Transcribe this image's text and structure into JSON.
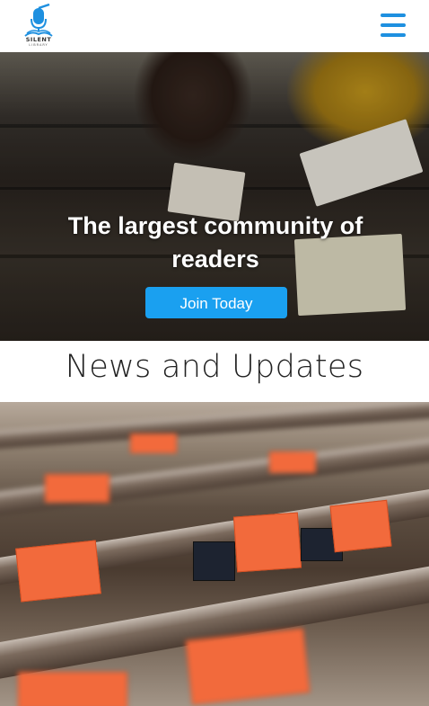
{
  "header": {
    "logo_icon": "microphone-book-icon",
    "logo_text": "SILENT",
    "logo_subtext": "LIBRARY",
    "menu_icon": "hamburger-menu-icon",
    "accent_color": "#1e90e0"
  },
  "hero": {
    "title": "The largest community of readers",
    "cta_label": "Join Today",
    "cta_color": "#1aa0f0"
  },
  "news": {
    "title": "News and Updates"
  }
}
